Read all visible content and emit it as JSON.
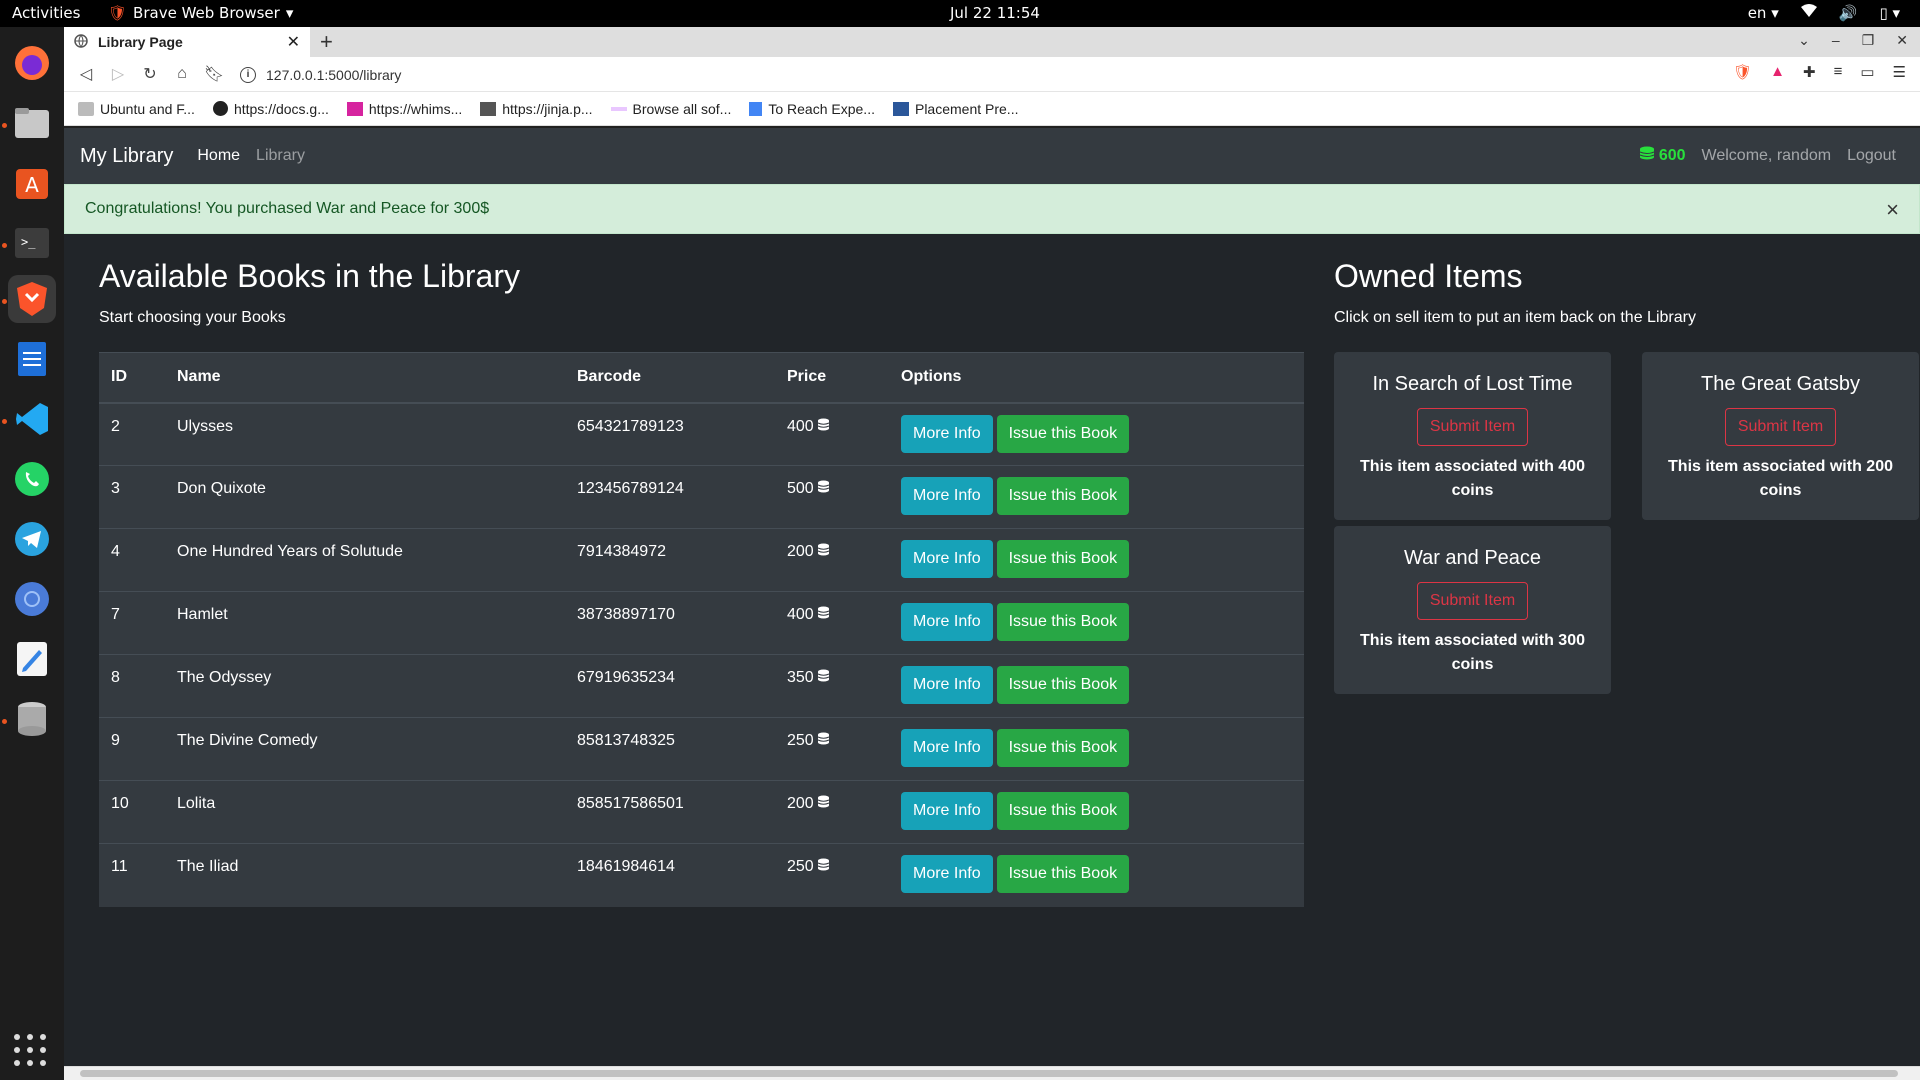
{
  "os": {
    "activities": "Activities",
    "app_name": "Brave Web Browser",
    "clock": "Jul 22  11:54",
    "lang": "en"
  },
  "browser": {
    "tab_title": "Library Page",
    "url": "127.0.0.1:5000/library",
    "bookmarks": [
      {
        "label": "Ubuntu and F...",
        "icon": "folder-icon"
      },
      {
        "label": "https://docs.g...",
        "icon": "github-icon"
      },
      {
        "label": "https://whims...",
        "icon": "whimsical-icon"
      },
      {
        "label": "https://jinja.p...",
        "icon": "jinja-icon"
      },
      {
        "label": "Browse all sof...",
        "icon": "software-icon"
      },
      {
        "label": "To Reach Expe...",
        "icon": "docs-icon"
      },
      {
        "label": "Placement Pre...",
        "icon": "word-icon"
      }
    ]
  },
  "site": {
    "brand": "My Library",
    "nav": {
      "home": "Home",
      "library": "Library"
    },
    "budget": "600",
    "welcome": "Welcome, random",
    "logout": "Logout",
    "alert": "Congratulations! You purchased War and Peace for 300$",
    "alert_close": "×"
  },
  "library": {
    "title": "Available Books in the Library",
    "subtitle": "Start choosing your Books",
    "columns": [
      "ID",
      "Name",
      "Barcode",
      "Price",
      "Options"
    ],
    "more_info_label": "More Info",
    "issue_label": "Issue this Book",
    "rows": [
      {
        "id": "2",
        "name": "Ulysses",
        "barcode": "654321789123",
        "price": "400"
      },
      {
        "id": "3",
        "name": "Don Quixote",
        "barcode": "123456789124",
        "price": "500"
      },
      {
        "id": "4",
        "name": "One Hundred Years of Solutude",
        "barcode": "7914384972",
        "price": "200"
      },
      {
        "id": "7",
        "name": "Hamlet",
        "barcode": "38738897170",
        "price": "400"
      },
      {
        "id": "8",
        "name": "The Odyssey",
        "barcode": "67919635234",
        "price": "350"
      },
      {
        "id": "9",
        "name": "The Divine Comedy",
        "barcode": "85813748325",
        "price": "250"
      },
      {
        "id": "10",
        "name": "Lolita",
        "barcode": "858517586501",
        "price": "200"
      },
      {
        "id": "11",
        "name": "The Iliad",
        "barcode": "18461984614",
        "price": "250"
      }
    ]
  },
  "owned": {
    "title": "Owned Items",
    "subtitle": "Click on sell item to put an item back on the Library",
    "submit_label": "Submit Item",
    "items": [
      {
        "name": "In Search of Lost Time",
        "text": "This item associated with 400 coins"
      },
      {
        "name": "The Great Gatsby",
        "text": "This item associated with 200 coins"
      },
      {
        "name": "War and Peace",
        "text": "This item associated with 300 coins"
      }
    ]
  },
  "colors": {
    "page_bg": "#212529",
    "navbar_bg": "#343a40",
    "info": "#17a2b8",
    "success": "#28a745",
    "danger": "#dc3545",
    "alert_bg": "#d4edda",
    "budget": "#28e03c"
  }
}
